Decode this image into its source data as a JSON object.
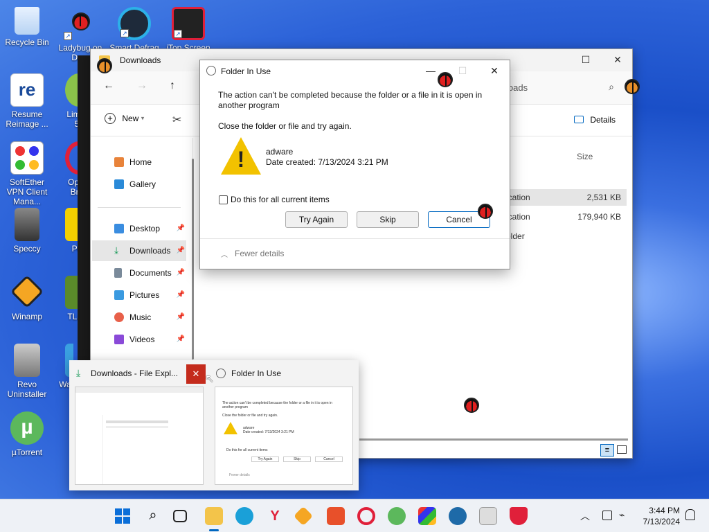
{
  "desktop": {
    "icons": [
      {
        "label": "Recycle Bin"
      },
      {
        "label": "Ladybug on De..."
      },
      {
        "label": "Smart Defrag"
      },
      {
        "label": "iTop Screen"
      },
      {
        "label": "Resume Reimage ..."
      },
      {
        "label": "Lim... 5"
      },
      {
        "label": "SoftEther VPN Client Mana..."
      },
      {
        "label": "Op... Bro"
      },
      {
        "label": "Speccy"
      },
      {
        "label": "Pe"
      },
      {
        "label": "Winamp"
      },
      {
        "label": "TLau"
      },
      {
        "label": "Revo Uninstaller"
      },
      {
        "label": "Wa"
      },
      {
        "label": "µTorrent"
      }
    ]
  },
  "explorer": {
    "title": "Downloads",
    "search_placeholder_tail": "loads",
    "cmd": {
      "new_label": "New",
      "details_label": "Details"
    },
    "columns": {
      "size": "Size"
    },
    "sidebar": [
      {
        "label": "Home"
      },
      {
        "label": "Gallery"
      },
      {
        "label": "Desktop"
      },
      {
        "label": "Downloads"
      },
      {
        "label": "Documents"
      },
      {
        "label": "Pictures"
      },
      {
        "label": "Music"
      },
      {
        "label": "Videos"
      }
    ],
    "files": [
      {
        "type": "ication",
        "size": "2,531 KB"
      },
      {
        "type": "ication",
        "size": "179,940 KB"
      },
      {
        "type": "older",
        "size": ""
      }
    ]
  },
  "dialog": {
    "title": "Folder In Use",
    "message": "The action can't be completed because the folder or a file in it is open in another program",
    "instruction": "Close the folder or file and try again.",
    "item_name": "adware",
    "item_date": "Date created: 7/13/2024 3:21 PM",
    "checkbox_label": "Do this for all current items",
    "buttons": {
      "try_again": "Try Again",
      "skip": "Skip",
      "cancel": "Cancel"
    },
    "fewer_details": "Fewer details"
  },
  "preview": {
    "explorer_title": "Downloads - File Expl...",
    "dialog_title": "Folder In Use",
    "thumb": {
      "message": "The action can't be completed because the folder or a file in it is open in another program",
      "instruction": "Close the folder or file and try again.",
      "item_name": "adware",
      "item_date": "Date created: 7/13/2024 3:21 PM",
      "checkbox_label": "Do this for all current items",
      "try_again": "Try Again",
      "skip": "Skip",
      "cancel": "Cancel",
      "fewer_details": "Fewer details"
    }
  },
  "taskbar": {
    "time": "3:44 PM",
    "date": "7/13/2024"
  }
}
